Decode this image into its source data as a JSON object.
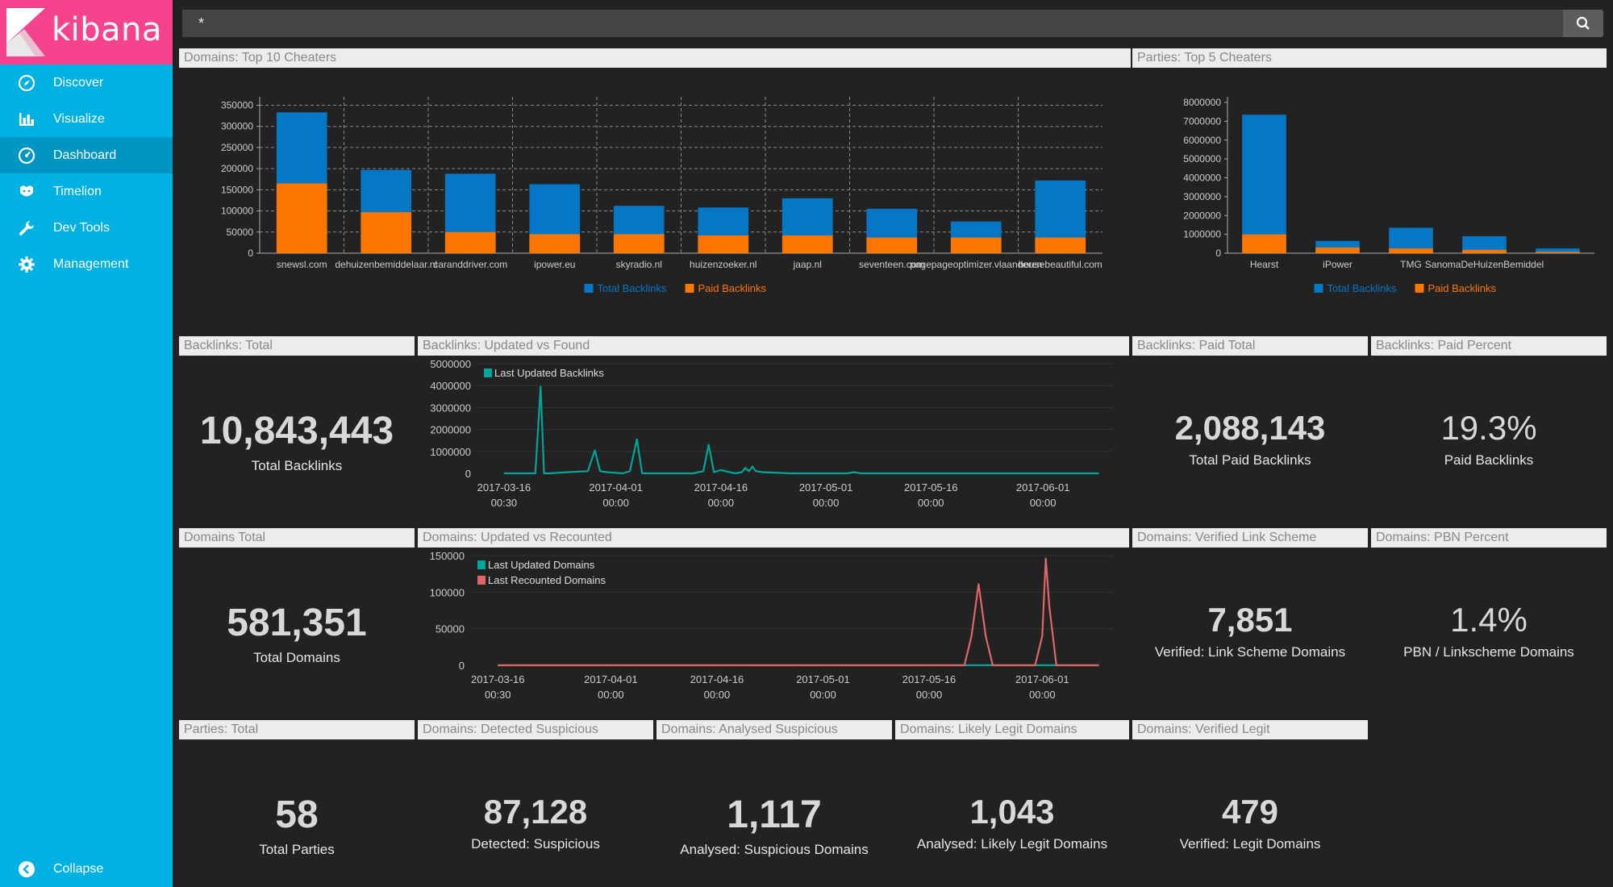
{
  "app": {
    "name": "kibana"
  },
  "sidebar": {
    "items": [
      {
        "label": "Discover",
        "icon": "compass-icon"
      },
      {
        "label": "Visualize",
        "icon": "bar-chart-icon"
      },
      {
        "label": "Dashboard",
        "icon": "dashboard-icon",
        "active": true
      },
      {
        "label": "Timelion",
        "icon": "timelion-icon"
      },
      {
        "label": "Dev Tools",
        "icon": "wrench-icon"
      },
      {
        "label": "Management",
        "icon": "gear-icon"
      }
    ],
    "collapse_label": "Collapse"
  },
  "query": {
    "value": "*"
  },
  "colors": {
    "sidebar": "#00b1e1",
    "logo": "#f5438e",
    "total_backlinks": "#0677c4",
    "paid_backlinks": "#fd7600",
    "teal": "#00a69b",
    "red": "#e0666a"
  },
  "panels": {
    "top10": {
      "title": "Domains: Top 10 Cheaters"
    },
    "top5": {
      "title": "Parties: Top 5 Cheaters"
    },
    "backlinks_total": {
      "title": "Backlinks: Total",
      "value": "10,843,443",
      "label": "Total Backlinks"
    },
    "backlinks_updated": {
      "title": "Backlinks: Updated vs Found"
    },
    "backlinks_paid_total": {
      "title": "Backlinks: Paid Total",
      "value": "2,088,143",
      "label": "Total Paid Backlinks"
    },
    "backlinks_paid_percent": {
      "title": "Backlinks: Paid Percent",
      "value": "19.3%",
      "label": "Paid Backlinks"
    },
    "domains_total": {
      "title": "Domains Total",
      "value": "581,351",
      "label": "Total Domains"
    },
    "domains_updated": {
      "title": "Domains: Updated vs Recounted"
    },
    "domains_verified_link_scheme": {
      "title": "Domains: Verified Link Scheme",
      "value": "7,851",
      "label": "Verified: Link Scheme Domains"
    },
    "domains_pbn_percent": {
      "title": "Domains: PBN Percent",
      "value": "1.4%",
      "label": "PBN / Linkscheme Domains"
    },
    "parties_total": {
      "title": "Parties: Total",
      "value": "58",
      "label": "Total Parties"
    },
    "domains_detected": {
      "title": "Domains: Detected Suspicious",
      "value": "87,128",
      "label": "Detected: Suspicious"
    },
    "domains_analysed": {
      "title": "Domains: Analysed Suspicious",
      "value": "1,117",
      "label": "Analysed: Suspicious Domains"
    },
    "domains_likely_legit": {
      "title": "Domains: Likely Legit Domains",
      "value": "1,043",
      "label": "Analysed: Likely Legit Domains"
    },
    "domains_verified_legit": {
      "title": "Domains: Verified Legit",
      "value": "479",
      "label": "Verified: Legit Domains"
    }
  },
  "chart_data": [
    {
      "type": "bar",
      "id": "top10",
      "categories": [
        "snewsl.com",
        "dehuizenbemiddelaar.nl",
        "caranddriver.com",
        "ipower.eu",
        "skyradio.nl",
        "huizenzoeker.nl",
        "jaap.nl",
        "seventeen.com",
        "pagepageoptimizer.vlaanderen",
        "housebeautiful.com"
      ],
      "series": [
        {
          "name": "Total Backlinks",
          "values": [
            333000,
            197000,
            188000,
            163000,
            112000,
            108000,
            130000,
            105000,
            75000,
            172000
          ]
        },
        {
          "name": "Paid Backlinks",
          "values": [
            165000,
            97000,
            50000,
            45000,
            45000,
            42000,
            42000,
            37000,
            37000,
            37000
          ]
        }
      ],
      "yticks": [
        0,
        50000,
        100000,
        150000,
        200000,
        250000,
        300000,
        350000
      ],
      "ylim": [
        0,
        370000
      ],
      "stacked": "overlay",
      "legend": "bottom"
    },
    {
      "type": "bar",
      "id": "top5",
      "categories": [
        "Hearst",
        "iPower",
        "TMG",
        "SanomaDeHuizenBemiddel"
      ],
      "series": [
        {
          "name": "Total Backlinks",
          "values": [
            7350000,
            650000,
            1350000,
            900000,
            250000
          ]
        },
        {
          "name": "Paid Backlinks",
          "values": [
            1000000,
            300000,
            250000,
            180000,
            70000
          ]
        }
      ],
      "yticks": [
        0,
        1000000,
        2000000,
        3000000,
        4000000,
        5000000,
        6000000,
        7000000,
        8000000
      ],
      "ylim": [
        0,
        8300000
      ],
      "legend": "bottom"
    },
    {
      "type": "line",
      "id": "backlinks_updated",
      "series": [
        {
          "name": "Last Updated Backlinks",
          "x": [
            "2017-03-16 00:30",
            "2017-03-20 12:00",
            "2017-03-21 06:00",
            "2017-03-21 18:00",
            "2017-03-22 12:00",
            "2017-03-25 00:00",
            "2017-03-28 00:00",
            "2017-03-29 00:00",
            "2017-03-29 18:00",
            "2017-03-30 18:00",
            "2017-04-02 00:00",
            "2017-04-03 00:00",
            "2017-04-04 00:00",
            "2017-04-04 18:00",
            "2017-04-05 18:00",
            "2017-04-08 00:00",
            "2017-04-12 00:00",
            "2017-04-13 12:00",
            "2017-04-14 06:00",
            "2017-04-15 00:00",
            "2017-04-16 00:00",
            "2017-04-18 00:00",
            "2017-04-19 00:00",
            "2017-04-19 12:00",
            "2017-04-20 00:00",
            "2017-04-20 12:00",
            "2017-04-21 00:00",
            "2017-04-22 00:00",
            "2017-04-26 00:00",
            "2017-05-04 00:00",
            "2017-05-05 00:00",
            "2017-05-06 00:00",
            "2017-05-10 00:00",
            "2017-06-09 00:00"
          ],
          "values": [
            0,
            0,
            3950000,
            0,
            0,
            50000,
            100000,
            1050000,
            100000,
            50000,
            0,
            100000,
            1550000,
            0,
            0,
            0,
            0,
            100000,
            1300000,
            50000,
            150000,
            0,
            50000,
            250000,
            100000,
            300000,
            100000,
            50000,
            0,
            0,
            50000,
            0,
            0,
            0
          ]
        }
      ],
      "xticks": [
        "2017-03-16 00:30",
        "2017-04-01 00:00",
        "2017-04-16 00:00",
        "2017-05-01 00:00",
        "2017-05-16 00:00",
        "2017-06-01 00:00"
      ],
      "yticks": [
        0,
        1000000,
        2000000,
        3000000,
        4000000,
        5000000
      ],
      "ylim": [
        0,
        5000000
      ],
      "legend": "top-left"
    },
    {
      "type": "line",
      "id": "domains_updated",
      "series": [
        {
          "name": "Last Updated Domains",
          "x": [
            "2017-03-16 00:30",
            "2017-06-09 00:00"
          ],
          "values": [
            0,
            0
          ]
        },
        {
          "name": "Last Recounted Domains",
          "x": [
            "2017-03-16 00:30",
            "2017-05-21 00:00",
            "2017-05-22 00:00",
            "2017-05-23 00:00",
            "2017-05-24 00:00",
            "2017-05-25 00:00",
            "2017-05-31 00:00",
            "2017-06-01 00:00",
            "2017-06-01 12:00",
            "2017-06-02 00:00",
            "2017-06-02 12:00",
            "2017-06-03 00:00",
            "2017-06-04 00:00",
            "2017-06-09 00:00"
          ],
          "values": [
            0,
            0,
            40000,
            111000,
            40000,
            0,
            0,
            40000,
            146000,
            80000,
            40000,
            0,
            0,
            0
          ]
        }
      ],
      "xticks": [
        "2017-03-16 00:30",
        "2017-04-01 00:00",
        "2017-04-16 00:00",
        "2017-05-01 00:00",
        "2017-05-16 00:00",
        "2017-06-01 00:00"
      ],
      "yticks": [
        0,
        50000,
        100000,
        150000
      ],
      "ylim": [
        0,
        150000
      ],
      "legend": "top-left"
    }
  ]
}
